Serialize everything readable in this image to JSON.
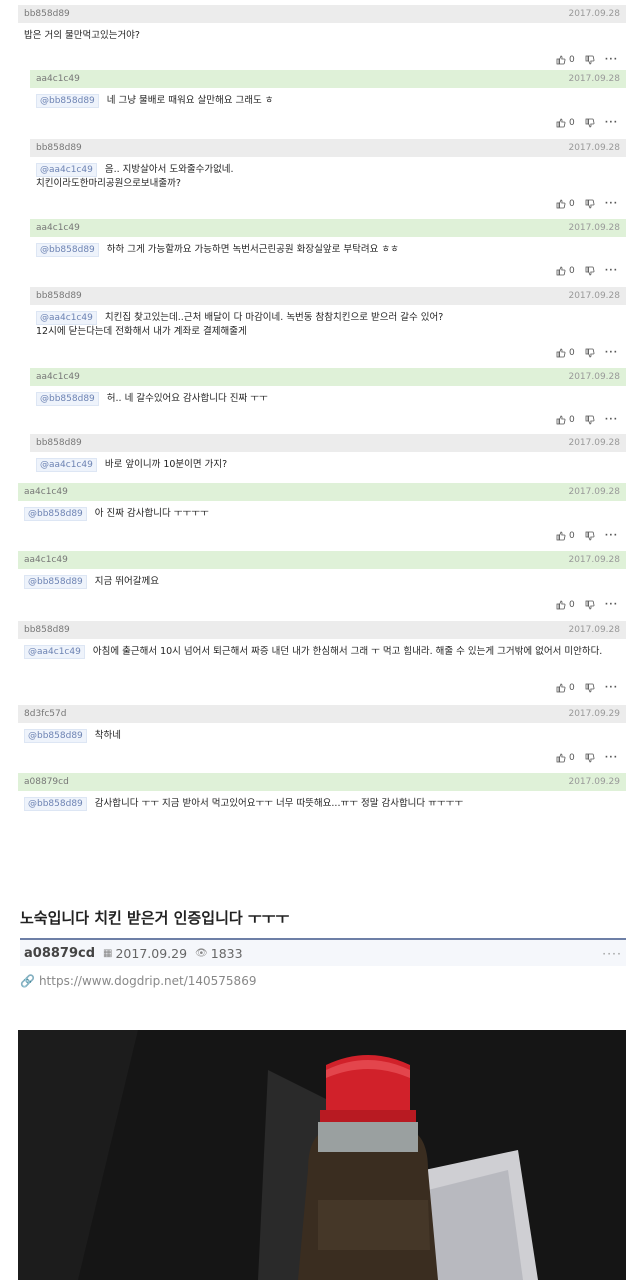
{
  "comments": [
    {
      "author": "bb858d89",
      "date": "2017.09.28",
      "mention": "",
      "text": "밥은 거의 물만먹고있는거야?",
      "likes": "0",
      "hl": "gray"
    },
    {
      "author": "aa4c1c49",
      "date": "2017.09.28",
      "mention": "@bb858d89",
      "text": "네 그냥 물배로 때워요 살만해요 그래도 ㅎ",
      "likes": "0",
      "hl": "green"
    },
    {
      "author": "bb858d89",
      "date": "2017.09.28",
      "mention": "@aa4c1c49",
      "text": "음.. 지방살아서 도와줄수가없네.\n치킨이라도한마리공원으로보내줄까?",
      "likes": "0",
      "hl": "gray"
    },
    {
      "author": "aa4c1c49",
      "date": "2017.09.28",
      "mention": "@bb858d89",
      "text": "하하 그게 가능할까요 가능하면 녹번서근린공원 화장실앞로 부탁려요 ㅎㅎ",
      "likes": "0",
      "hl": "green"
    },
    {
      "author": "bb858d89",
      "date": "2017.09.28",
      "mention": "@aa4c1c49",
      "text": "치킨집 찾고있는데..근처 배달이 다 마감이네. 녹번동 참참치킨으로 받으러 갈수 있어?\n12시에 닫는다는데 전화해서 내가 계좌로 결제해줄게",
      "likes": "0",
      "hl": "gray"
    },
    {
      "author": "aa4c1c49",
      "date": "2017.09.28",
      "mention": "@bb858d89",
      "text": "허.. 네 갈수있어요 감사합니다 진짜 ㅜㅜ",
      "likes": "0",
      "hl": "green"
    },
    {
      "author": "bb858d89",
      "date": "2017.09.28",
      "mention": "@aa4c1c49",
      "text": "바로 앞이니까 10분이면 가지?",
      "likes": "",
      "hl": "gray"
    },
    {
      "author": "aa4c1c49",
      "date": "2017.09.28",
      "mention": "@bb858d89",
      "text": "아 진짜 감사합니다 ㅜㅜㅜㅜ",
      "likes": "0",
      "hl": "green"
    },
    {
      "author": "aa4c1c49",
      "date": "2017.09.28",
      "mention": "@bb858d89",
      "text": "지금 뛰어갈께요",
      "likes": "0",
      "hl": "green"
    },
    {
      "author": "bb858d89",
      "date": "2017.09.28",
      "mention": "@aa4c1c49",
      "text": "아침에 출근해서 10시 넘어서 퇴근해서 짜증 내던 내가 한심해서 그래 ㅜ 먹고 힘내라. 해줄 수 있는게 그거밖에 없어서 미안하다.",
      "likes": "0",
      "hl": "gray"
    },
    {
      "author": "8d3fc57d",
      "date": "2017.09.29",
      "mention": "@bb858d89",
      "text": "착하네",
      "likes": "0",
      "hl": "gray"
    },
    {
      "author": "a08879cd",
      "date": "2017.09.29",
      "mention": "@bb858d89",
      "text": "감사합니다 ㅜㅜ 지금 받아서 먹고있어요ㅜㅜ 너무 따뜻해요...ㅠㅜ 정말 감사합니다 ㅠㅜㅜㅜ",
      "likes": "",
      "hl": "green"
    }
  ],
  "post": {
    "title": "노숙입니다 치킨 받은거 인증입니다 ㅜㅜㅜ",
    "author": "a08879cd",
    "date": "2017.09.29",
    "views": "1833",
    "url": "https://www.dogdrip.net/140575869",
    "more": "····"
  },
  "icons": {
    "like": "thumbs-up-icon",
    "dislike": "thumbs-down-icon",
    "more": "more-dots-icon",
    "calendar": "calendar-icon",
    "views": "eye-icon",
    "link": "link-icon"
  },
  "colors": {
    "green_head": "#dff1d8",
    "gray_head": "#ececec",
    "meta_border": "#6d7fa6"
  },
  "ui": {
    "more_dots": "···"
  }
}
